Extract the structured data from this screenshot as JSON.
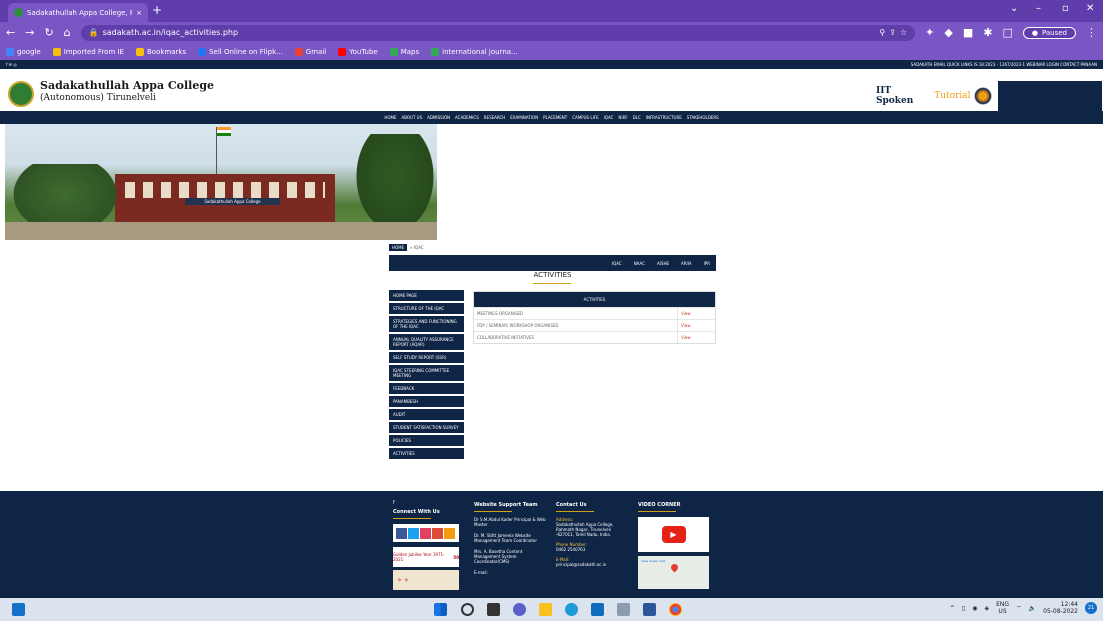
{
  "browser": {
    "tab_title": "Sadakathullah Appa College, Pal",
    "tab_close": "×",
    "new_tab": "+",
    "url": "sadakath.ac.in/iqac_activities.php",
    "profile_status": "Paused",
    "nav_icons": [
      "back-icon",
      "forward-icon",
      "reload-icon",
      "home-icon"
    ],
    "bookmarks": [
      {
        "label": "google",
        "color": "#4285f4"
      },
      {
        "label": "Imported From IE",
        "color": "#f4c20d"
      },
      {
        "label": "Bookmarks",
        "color": "#f4c20d"
      },
      {
        "label": "Sell Online on Flipk...",
        "color": "#2874f0"
      },
      {
        "label": "Gmail",
        "color": "#ea4335"
      },
      {
        "label": "YouTube",
        "color": "#ff0000"
      },
      {
        "label": "Maps",
        "color": "#34a853"
      },
      {
        "label": "international journa...",
        "color": "#34a853"
      }
    ]
  },
  "site": {
    "college_name": "Sadakathullah Appa College",
    "college_sub": "(Autonomous) Tirunelveli",
    "spoken_a": "IIT Spoken",
    "spoken_b": "Tutorial",
    "topstrip_left": "f  ✉  ◎",
    "topstrip_right": "SADAKATH EMAIL   QUICK LINKS   IS 18:2023 - 1367/2023-1   WEBINAR   LOGIN   CONTACT   PANAAN",
    "nav": [
      "HOME",
      "ABOUT US",
      "ADMISSION",
      "ACADEMICS",
      "RESEARCH",
      "EXAMINATION",
      "PLACEMENT",
      "CAMPUS LIFE",
      "IQAC",
      "NIRF",
      "DLC",
      "INFRASTRUCTURE",
      "STAKEHOLDERS"
    ],
    "banner_label": "Sadakathullah Appa College",
    "breadcrumb_home": "HOME",
    "breadcrumb_current": "» IQAC",
    "subnav": [
      "IQAC",
      "NAAC",
      "AISHE",
      "ARIIA",
      "IPR"
    ],
    "page_title": "ACTIVITIES",
    "sidebar": [
      "HOME PAGE",
      "STRUCTURE OF THE IQAC",
      "STRATEGIES AND FUNCTIONING OF THE IQAC",
      "ANNUAL QUALITY ASSURANCE REPORT (AQAR)",
      "SELF STUDY REPORT (SSR)",
      "IQAC STEERING COMMITTEE MEETING",
      "FEEDBACK",
      "PANAMBESH",
      "AUDIT",
      "STUDENT SATISFACTION SURVEY",
      "POLICIES",
      "ACTIVITIES"
    ],
    "table_header": "ACTIVITIES",
    "table_rows": [
      {
        "name": "MEETINGS ORGANISED",
        "action": "View"
      },
      {
        "name": "FDP / SEMINAR/ WORKSHOP ORGANISED",
        "action": "View"
      },
      {
        "name": "COLLABORATIVE INITIATIVES",
        "action": "View"
      }
    ]
  },
  "footer": {
    "connect_title": "Connect With Us",
    "jubilee": "Golden Jubilee Year 1971-2021",
    "jubilee_num": "50",
    "support_title": "Website Support Team",
    "support": [
      "Dr S.M.Abdul Kader Principal & Web Master",
      "Dr. M. Stiltt Jameela Website Management Team Coordinator",
      "Mrs. A. Basetha Content Management System Coordinator(CMS)",
      "E-mail:"
    ],
    "contact_title": "Contact Us",
    "address_label": "Address:",
    "address": "Sadakathullah Appa College, Rahmath Nagar, Tirunelveli -627011, Tamil Nadu, India.",
    "phone_label": "Phone Number:",
    "phone": "0462 2540763",
    "email_label": "E-Mail:",
    "email": "principal@sadakath.ac.in",
    "video_title": "VIDEO CORNER",
    "map_label": "View larger map",
    "pin_label": "f"
  },
  "taskbar": {
    "lang": "ENG",
    "region": "US",
    "time": "12:44",
    "date": "05-08-2022",
    "notif": "21"
  }
}
